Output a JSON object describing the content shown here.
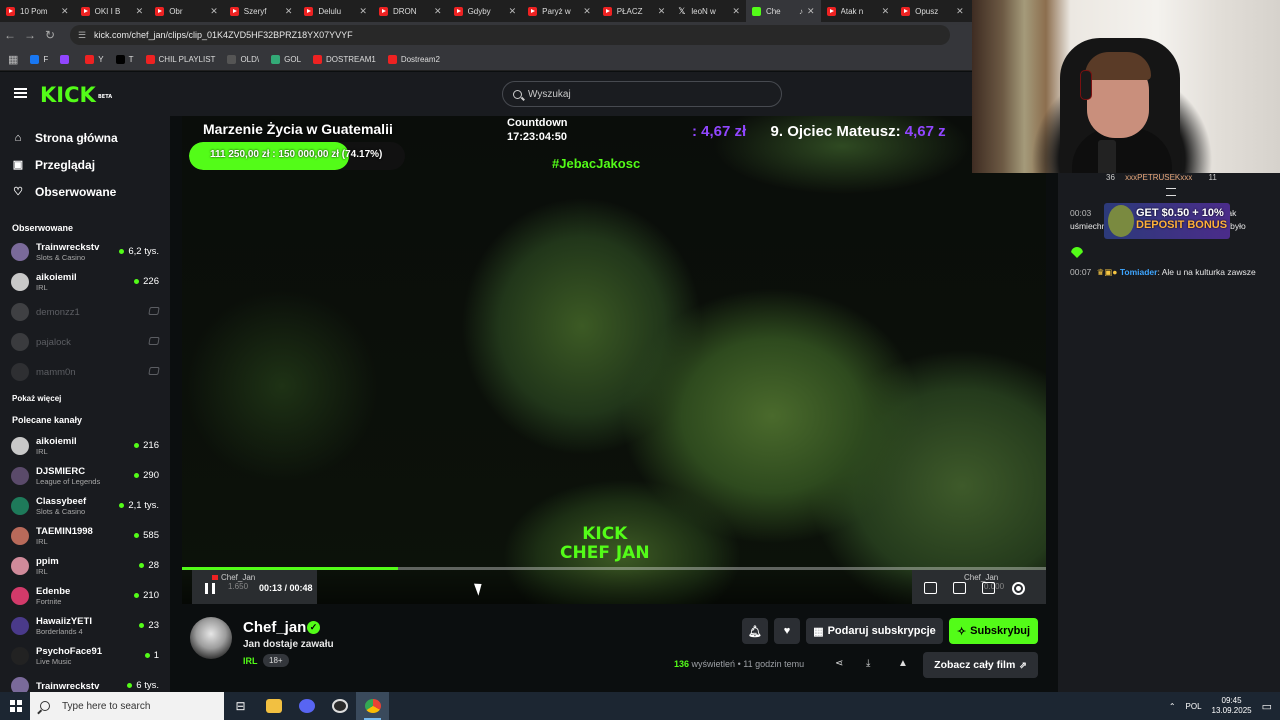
{
  "browser": {
    "tabs": [
      {
        "title": "10 Pom",
        "icon": "youtube"
      },
      {
        "title": "OKI I B",
        "icon": "youtube"
      },
      {
        "title": "Obr",
        "icon": "youtube"
      },
      {
        "title": "Szeryf",
        "icon": "youtube"
      },
      {
        "title": "Delulu",
        "icon": "youtube"
      },
      {
        "title": "DRON",
        "icon": "youtube"
      },
      {
        "title": "Gdyby",
        "icon": "youtube"
      },
      {
        "title": "Paryż w",
        "icon": "youtube"
      },
      {
        "title": "PŁACZ",
        "icon": "youtube"
      },
      {
        "title": "leoN w",
        "icon": "x"
      },
      {
        "title": "Che",
        "icon": "kick",
        "active": true
      },
      {
        "title": "Atak n",
        "icon": "youtube"
      },
      {
        "title": "Opusz",
        "icon": "youtube"
      }
    ],
    "url": "kick.com/chef_jan/clips/clip_01K4ZVD5HF32BPRZ18YX07YVYF",
    "bookmarks": [
      {
        "label": "F",
        "color": "#1877f2"
      },
      {
        "label": "",
        "color": "#9146ff"
      },
      {
        "label": "Y",
        "color": "#e22"
      },
      {
        "label": "T",
        "color": "#000"
      },
      {
        "label": "CHIL PLAYLIST",
        "color": "#e22"
      },
      {
        "label": "OLD\\",
        "color": "#555"
      },
      {
        "label": "GOL",
        "color": "#3a7"
      },
      {
        "label": "DOSTREAM1",
        "color": "#e22"
      },
      {
        "label": "Dostream2",
        "color": "#e22"
      }
    ]
  },
  "header": {
    "logo": "KICK",
    "logo_badge": "BETA",
    "search_placeholder": "Wyszukaj"
  },
  "sidebar": {
    "nav": [
      {
        "label": "Strona główna",
        "icon": "home-icon"
      },
      {
        "label": "Przeglądaj",
        "icon": "browse-icon"
      },
      {
        "label": "Obserwowane",
        "icon": "heart-icon"
      }
    ],
    "followed_title": "Obserwowane",
    "followed": [
      {
        "name": "Trainwreckstv",
        "category": "Slots & Casino",
        "viewers": "6,2 tys.",
        "live": true,
        "color": "#7a6a9a"
      },
      {
        "name": "aikoiemil",
        "category": "IRL",
        "viewers": "226",
        "live": true,
        "color": "#c8c8c8"
      },
      {
        "name": "demonzz1",
        "category": "",
        "viewers": "",
        "live": false,
        "color": "#888"
      },
      {
        "name": "pajalock",
        "category": "",
        "viewers": "",
        "live": false,
        "color": "#777"
      },
      {
        "name": "mamm0n",
        "category": "",
        "viewers": "",
        "live": false,
        "color": "#555"
      }
    ],
    "show_more": "Pokaż więcej",
    "recommended_title": "Polecane kanały",
    "recommended": [
      {
        "name": "aikoiemil",
        "category": "IRL",
        "viewers": "216",
        "color": "#c8c8c8"
      },
      {
        "name": "DJSMIERC",
        "category": "League of Legends",
        "viewers": "290",
        "color": "#5a4a6a"
      },
      {
        "name": "Classybeef",
        "category": "Slots & Casino",
        "viewers": "2,1 tys.",
        "color": "#1e7a5a"
      },
      {
        "name": "TAEMIN1998",
        "category": "IRL",
        "viewers": "585",
        "color": "#b86a5a"
      },
      {
        "name": "ppim",
        "category": "IRL",
        "viewers": "28",
        "color": "#d08a9a"
      },
      {
        "name": "Edenbe",
        "category": "Fortnite",
        "viewers": "210",
        "color": "#d23a6a"
      },
      {
        "name": "HawaiizYETI",
        "category": "Borderlands 4",
        "viewers": "23",
        "color": "#4a3a8a"
      },
      {
        "name": "PsychoFace91",
        "category": "Live Music",
        "viewers": "1",
        "color": "#222"
      },
      {
        "name": "Trainwreckstv",
        "category": "",
        "viewers": "6 tys.",
        "color": "#7a6a9a"
      }
    ]
  },
  "video": {
    "overlay_title": "Marzenie Życia w Guatemalii",
    "goal_text": "111 250,00 zł : 150 000,00 zł (74.17%)",
    "goal_progress": 0.7417,
    "countdown_label": "Countdown",
    "countdown_value": "17:23:04:50",
    "ticker_amount_a": ": 4,67 zł",
    "ticker_name": "9. Ojciec Mateusz:",
    "ticker_amount_b": "4,67 z",
    "hashtag": "#JebacJakosc",
    "watermark_line1": "KICK",
    "watermark_line2": "CHEF JAN",
    "time": "00:13 / 00:48",
    "progress": 0.25,
    "thumb_left_label": "Chef_Jan",
    "thumb_left_sub": "1.650",
    "thumb_right_label": "Chef_Jan",
    "thumb_right_sub": "0.000"
  },
  "channel": {
    "name": "Chef_jan",
    "title": "Jan dostaje zawału",
    "category": "IRL",
    "age": "18+",
    "views": "136",
    "views_label": "wyświetleń",
    "separator": "•",
    "ago": "11 godzin temu",
    "gift_label": "Podaruj subskrypcje",
    "subscribe_label": "Subskrybuj",
    "full_film_label": "Zobacz cały film"
  },
  "chat": {
    "top_user": "xxxPETRUSEKxxx",
    "top_left": "36",
    "top_right": "11",
    "messages": [
      {
        "time": "00:03",
        "text": "że ja sie wzruszy i byli tak uśmiechnięci i szczęśliwi, cos pięknego to było"
      },
      {
        "time": "00:07",
        "user": "Tomiader",
        "text": ": Ale u na kulturka zawsze"
      }
    ],
    "ad_line1": "GET $0.50 + 10%",
    "ad_line2": "DEPOSIT BONUS"
  },
  "taskbar": {
    "search_placeholder": "Type here to search",
    "language": "POL",
    "time": "09:45",
    "date": "13.09.2025"
  }
}
